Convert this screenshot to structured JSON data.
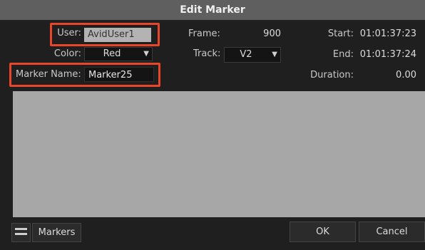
{
  "window": {
    "title": "Edit Marker"
  },
  "fields": {
    "user_label": "User:",
    "user_value": "AvidUser1",
    "color_label": "Color:",
    "color_value": "Red",
    "marker_name_label": "Marker Name:",
    "marker_name_value": "Marker25",
    "frame_label": "Frame:",
    "frame_value": "900",
    "track_label": "Track:",
    "track_value": "V2",
    "start_label": "Start:",
    "start_value": "01:01:37:23",
    "end_label": "End:",
    "end_value": "01:01:37:24",
    "duration_label": "Duration:",
    "duration_value": "0.00"
  },
  "comment": {
    "value": ""
  },
  "footer": {
    "markers_label": "Markers",
    "ok_label": "OK",
    "cancel_label": "Cancel"
  },
  "colors": {
    "highlight": "#e8452a",
    "dialog_bg": "#1f1f1f",
    "titlebar_bg": "#5f5f5f",
    "comment_bg": "#a7a7a7"
  },
  "icons": {
    "menu": "hamburger-menu-icon",
    "dropdown": "triangle-down-icon"
  }
}
